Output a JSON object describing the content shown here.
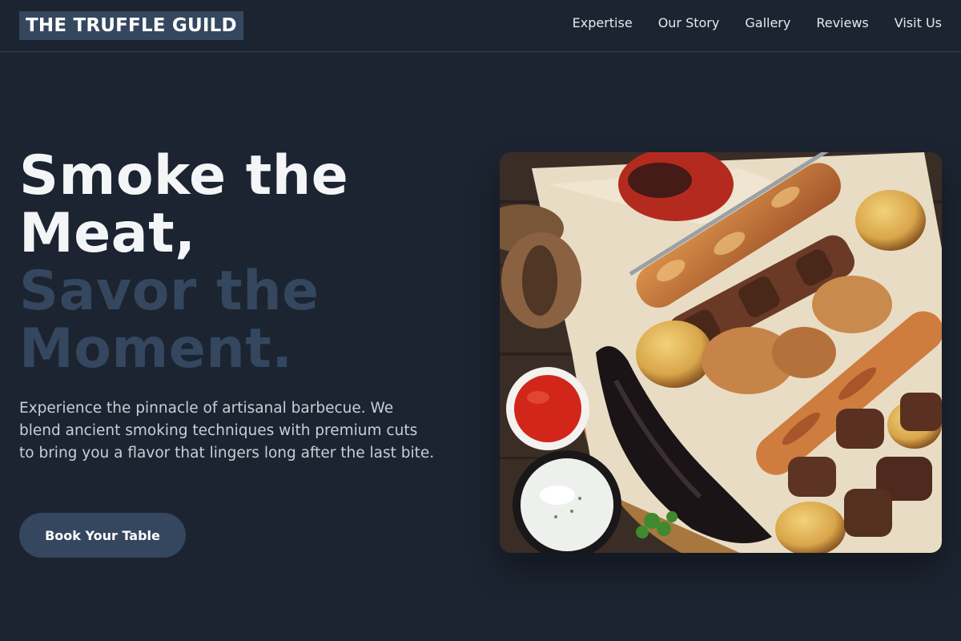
{
  "brand": {
    "name": "THE TRUFFLE GUILD"
  },
  "nav": {
    "items": [
      {
        "label": "Expertise"
      },
      {
        "label": "Our Story"
      },
      {
        "label": "Gallery"
      },
      {
        "label": "Reviews"
      },
      {
        "label": "Visit Us"
      }
    ]
  },
  "hero": {
    "title_line_1": "Smoke the",
    "title_line_2": "Meat,",
    "title_line_3": "Savor the",
    "title_line_4": "Moment.",
    "description": "Experience the pinnacle of artisanal barbecue. We blend ancient smoking techniques with premium cuts to bring you a flavor that lingers long after the last bite.",
    "cta_label": "Book Your Table"
  },
  "colors": {
    "background": "#1c2431",
    "accent": "#34475e",
    "text_primary": "#f3f5f7",
    "text_secondary": "#c9ced6"
  }
}
